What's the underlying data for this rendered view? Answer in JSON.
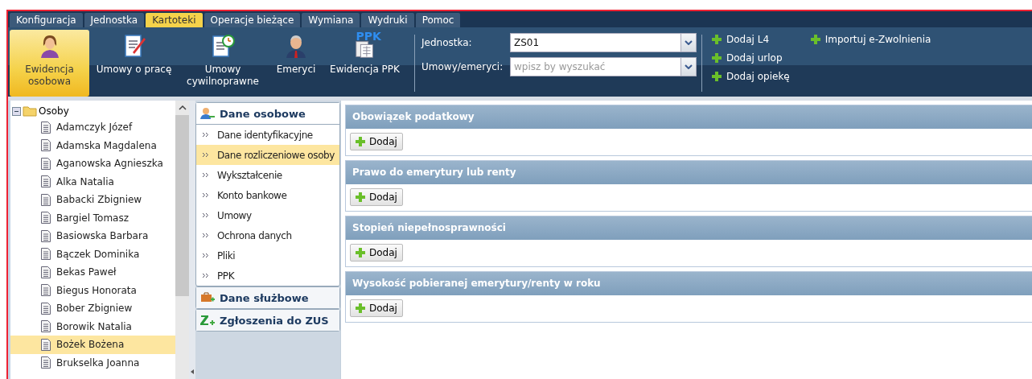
{
  "menu": [
    {
      "label": "Konfiguracja",
      "selected": false
    },
    {
      "label": "Jednostka",
      "selected": false
    },
    {
      "label": "Kartoteki",
      "selected": true
    },
    {
      "label": "Operacje bieżące",
      "selected": false
    },
    {
      "label": "Wymiana",
      "selected": false
    },
    {
      "label": "Wydruki",
      "selected": false
    },
    {
      "label": "Pomoc",
      "selected": false
    }
  ],
  "ribbon": [
    {
      "label": "Ewidencja osobowa",
      "selected": true
    },
    {
      "label": "Umowy o pracę",
      "selected": false
    },
    {
      "label": "Umowy cywilnoprawne",
      "selected": false
    },
    {
      "label": "Emeryci",
      "selected": false
    },
    {
      "label": "Ewidencja PPK",
      "selected": false,
      "badge": "PPK"
    }
  ],
  "unit_field": {
    "label": "Jednostka:",
    "value": "ZS01"
  },
  "contract_field": {
    "label": "Umowy/emeryci:",
    "placeholder": "wpisz by wyszukać"
  },
  "actions": [
    "Dodaj L4",
    "Dodaj urlop",
    "Dodaj opiekę",
    "Importuj e-Zwolnienia"
  ],
  "tree": {
    "label": "Osoby",
    "expanded": true,
    "children": [
      {
        "label": "Adamczyk Józef",
        "selected": false
      },
      {
        "label": "Adamska Magdalena",
        "selected": false
      },
      {
        "label": "Aganowska Agnieszka",
        "selected": false
      },
      {
        "label": "Alka Natalia",
        "selected": false
      },
      {
        "label": "Babacki Zbigniew",
        "selected": false
      },
      {
        "label": "Bargiel Tomasz",
        "selected": false
      },
      {
        "label": "Basiowska Barbara",
        "selected": false
      },
      {
        "label": "Bączek Dominika",
        "selected": false
      },
      {
        "label": "Bekas Paweł",
        "selected": false
      },
      {
        "label": "Biegus Honorata",
        "selected": false
      },
      {
        "label": "Bober Zbigniew",
        "selected": false
      },
      {
        "label": "Borowik Natalia",
        "selected": false
      },
      {
        "label": "Bożek Bożena",
        "selected": true
      },
      {
        "label": "Brukselka Joanna",
        "selected": false
      }
    ]
  },
  "nav": [
    {
      "title": "Dane osobowe",
      "expanded": true,
      "items": [
        {
          "label": "Dane identyfikacyjne",
          "selected": false
        },
        {
          "label": "Dane rozliczeniowe osoby",
          "selected": true
        },
        {
          "label": "Wykształcenie",
          "selected": false
        },
        {
          "label": "Konto bankowe",
          "selected": false
        },
        {
          "label": "Umowy",
          "selected": false
        },
        {
          "label": "Ochrona danych",
          "selected": false
        },
        {
          "label": "Pliki",
          "selected": false
        },
        {
          "label": "PPK",
          "selected": false
        }
      ]
    },
    {
      "title": "Dane służbowe",
      "expanded": false
    },
    {
      "title": "Zgłoszenia do ZUS",
      "expanded": false
    }
  ],
  "panels": [
    {
      "title": "Obowiązek podatkowy",
      "button": "Dodaj"
    },
    {
      "title": "Prawo do emerytury lub renty",
      "button": "Dodaj"
    },
    {
      "title": "Stopień niepełnosprawności",
      "button": "Dodaj"
    },
    {
      "title": "Wysokość pobieranej emerytury/renty w roku",
      "button": "Dodaj"
    }
  ]
}
